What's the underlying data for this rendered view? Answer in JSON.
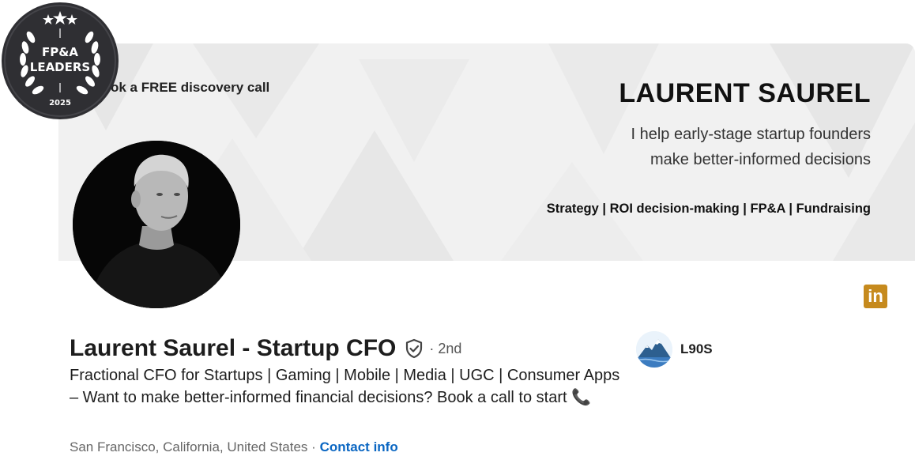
{
  "badge": {
    "line1": "FP&A",
    "line2": "LEADERS",
    "year": "2025"
  },
  "banner": {
    "cta": "ok a FREE discovery call",
    "name": "LAURENT SAUREL",
    "tagline_line1": "I help early-stage startup founders",
    "tagline_line2": "make better-informed decisions",
    "skills": "Strategy | ROI decision-making | FP&A | Fundraising"
  },
  "social": {
    "linkedin_icon": "linkedin-icon",
    "linkedin_text": "in",
    "linkedin_color": "#c68a1d"
  },
  "profile": {
    "name": "Laurent Saurel - Startup CFO",
    "degree": "· 2nd",
    "headline": "Fractional CFO for Startups | Gaming | Mobile | Media | UGC | Consumer Apps – Want to make better-informed financial decisions? Book a call to start",
    "headline_icon": "📞",
    "location": "San Francisco, California, United States",
    "separator": "·",
    "contact_info": "Contact info",
    "link_color": "#0a66c2"
  },
  "company": {
    "name": "L90S",
    "logo_icon": "mountain-logo-icon"
  }
}
